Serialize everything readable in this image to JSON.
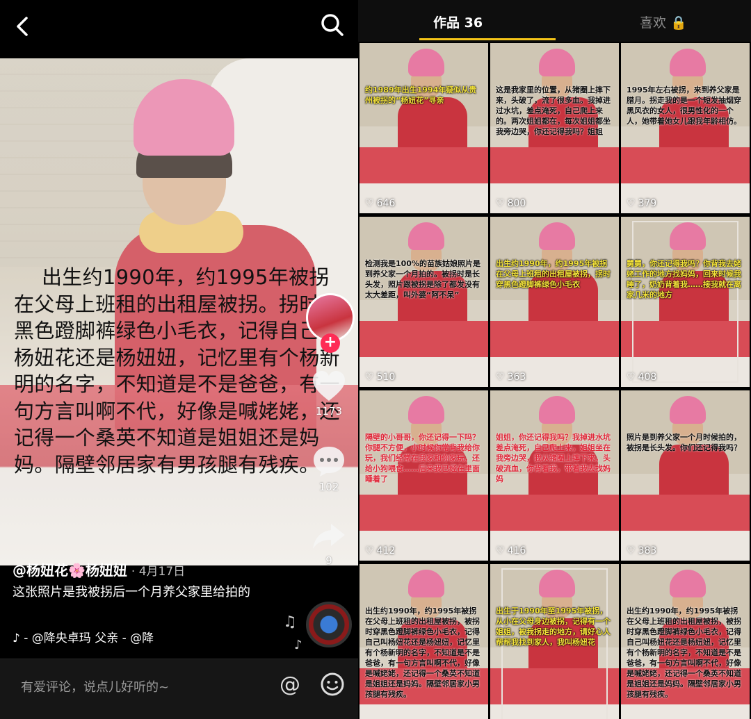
{
  "left": {
    "caption": "出生约1990年，约1995年被拐在父母上班租的出租屋被拐。拐时穿黑色蹬脚裤绿色小毛衣，记得自己叫杨妞花还是杨妞妞，记忆里有个杨新明的名字，不知道是不是爸爸，有一句方言叫啊不代，好像是喊姥姥，还记得一个桑英不知道是姐姐还是妈妈。隔壁邻居家有男孩腿有残疾。",
    "likes": "1173",
    "comments": "102",
    "shares": "9",
    "author": "@杨妞花🌸杨妞妞",
    "date": "· 4月17日",
    "description": "这张照片是我被拐后一个月养父家里给拍的",
    "music": "♪  - @降央卓玛    父亲 - @降",
    "comment_placeholder": "有爱评论，说点儿好听的~",
    "at_symbol": "@",
    "follow_plus": "+"
  },
  "tabs": {
    "works": "作品 36",
    "likes": "喜欢 🔒"
  },
  "tiles": [
    {
      "text": "约1989年出生1994年疑似从贵州被拐的“杨妞花”寻亲",
      "style": "yellow",
      "likes": "646"
    },
    {
      "text": "这是我家里的位置，从猪圈上摔下来，头破了，流了很多血。我掉进过水坑，差点淹死，自己爬上来的。两次姐姐都在，每次姐姐都坐我旁边哭，你还记得我吗？姐姐",
      "style": "dark",
      "likes": "800"
    },
    {
      "text": "1995年左右被拐，来到养父家是腊月。拐走我的是一个短发抽烟穿黑风衣的女人，很男性化的一个人，她带着她女儿跟我年龄相仿。",
      "style": "dark",
      "likes": "379"
    },
    {
      "text": "检测我是100%的苗族姑娘照片是到养父家一个月拍的。被拐时是长头发，照片跟被拐是除了都发没有太大差距，叫外婆“阿不呆”",
      "style": "dark",
      "likes": "510"
    },
    {
      "text": "出生约1990年，约1995年被拐在父母上班租的出租屋被拐，拐时穿黑色蹬脚裤绿色小毛衣",
      "style": "yellow",
      "likes": "363"
    },
    {
      "text": "舅舅，你还记得我吗？你背我去姥姥工作的地方找妈妈，回来时候我睡了，奶奶背着我……接我就在离家几米的地方",
      "style": "yellow",
      "likes": "408"
    },
    {
      "text": "隔壁的小哥哥，你还记得一下吗？你腿不方便，小时候你常背我给你玩，我们经常在我家和你家玩，还给小狗喂食……后来我已经在里面睡着了",
      "style": "red",
      "likes": "412"
    },
    {
      "text": "姐姐，你还记得我吗？我掉进水坑差点淹死，自己爬上来，姐姐坐在我旁边哭，我从猪圈上摔下来，头破流血，你背着我，带着我去找妈妈",
      "style": "red",
      "likes": "416"
    },
    {
      "text": "照片是到养父家一个月时候拍的，被拐是长头发。你们还记得我吗？",
      "style": "dark",
      "likes": "383"
    },
    {
      "text": "出生约1990年，约1995年被拐在父母上班租的出租屋被拐，被拐时穿黑色蹬脚裤绿色小毛衣，记得自己叫杨妞花还是杨妞妞，记忆里有个杨新明的名字，不知道是不是爸爸，有一句方言叫啊不代，好像是喊姥姥，还记得一个桑英不知道是姐姐还是妈妈。隔壁邻居家小男孩腿有残疾。",
      "style": "dark",
      "likes": ""
    },
    {
      "text": "出生于1990年至1995年被拐，从小在父母身边被拐，记得有一个姐姐，被我拐走的地方，请好心人帮帮我找到家人，我叫杨妞花",
      "style": "yellow",
      "likes": ""
    },
    {
      "text": "出生约1990年，约1995年被拐在父母上班租的出租屋被拐，被拐时穿黑色蹬脚裤绿色小毛衣，记得自己叫杨妞花还是杨妞妞，记忆里有个杨新明的名字，不知道是不是爸爸，有一句方言叫啊不代，好像是喊姥姥，还记得一个桑英不知道是姐姐还是妈妈。隔壁邻居家小男孩腿有残疾。",
      "style": "dark",
      "likes": ""
    }
  ]
}
